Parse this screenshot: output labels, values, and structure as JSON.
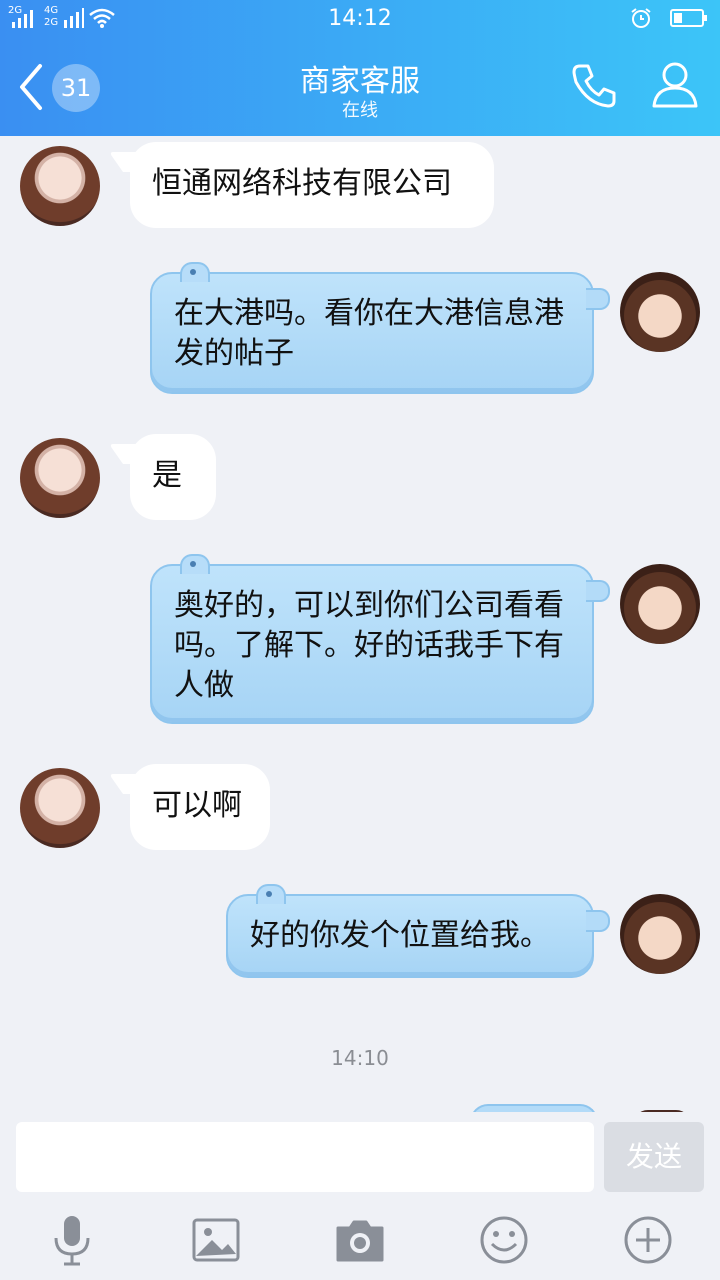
{
  "status_bar": {
    "signal1": "2G",
    "signal2_top": "4G",
    "signal2_bottom": "2G",
    "time": "14:12"
  },
  "header": {
    "unread_count": "31",
    "title": "商家客服",
    "subtitle": "在线"
  },
  "messages": [
    {
      "side": "left",
      "text": "恒通网络科技有限公司"
    },
    {
      "side": "right",
      "text": "在大港吗。看你在大港信息港发的帖子"
    },
    {
      "side": "left",
      "text": "是"
    },
    {
      "side": "right",
      "text": "奥好的，可以到你们公司看看吗。了解下。好的话我手下有人做"
    },
    {
      "side": "left",
      "text": "可以啊"
    },
    {
      "side": "right",
      "text": "好的你发个位置给我。"
    }
  ],
  "timestamp": "14:10",
  "composer": {
    "input_value": "",
    "send_label": "发送"
  },
  "toolbar_icons": [
    "microphone-icon",
    "image-icon",
    "camera-icon",
    "emoji-icon",
    "plus-icon"
  ],
  "colors": {
    "header_start": "#3a8ff2",
    "header_end": "#3cc5f8",
    "self_bubble": "#a6d4f5",
    "background": "#eff1f6"
  }
}
